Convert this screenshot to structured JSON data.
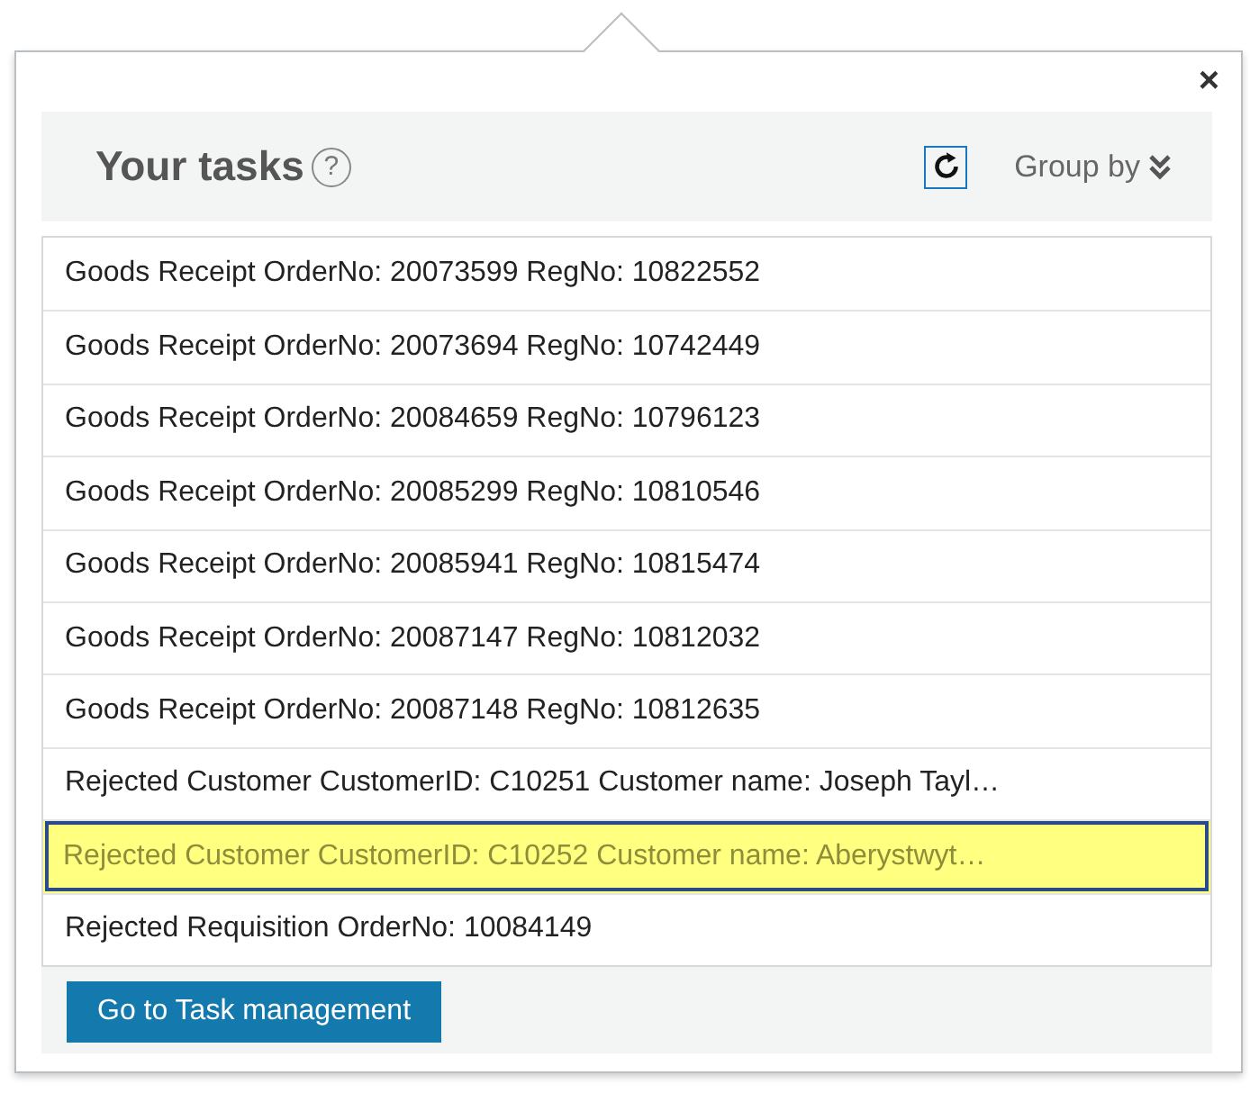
{
  "close": "×",
  "header": {
    "title": "Your tasks",
    "help": "?",
    "group_by": "Group by"
  },
  "tasks": [
    {
      "text": "Goods Receipt OrderNo: 20073599 RegNo: 10822552",
      "selected": false
    },
    {
      "text": "Goods Receipt OrderNo: 20073694 RegNo: 10742449",
      "selected": false
    },
    {
      "text": "Goods Receipt OrderNo: 20084659 RegNo: 10796123",
      "selected": false
    },
    {
      "text": "Goods Receipt OrderNo: 20085299 RegNo: 10810546",
      "selected": false
    },
    {
      "text": "Goods Receipt OrderNo: 20085941 RegNo: 10815474",
      "selected": false
    },
    {
      "text": "Goods Receipt OrderNo: 20087147 RegNo: 10812032",
      "selected": false
    },
    {
      "text": "Goods Receipt OrderNo: 20087148 RegNo: 10812635",
      "selected": false
    },
    {
      "text": "Rejected Customer CustomerID: C10251 Customer name: Joseph Tayl…",
      "selected": false
    },
    {
      "text": "Rejected Customer CustomerID: C10252 Customer name: Aberystwyt…",
      "selected": true
    },
    {
      "text": "Rejected Requisition OrderNo: 10084149",
      "selected": false
    }
  ],
  "footer": {
    "button": "Go to Task management"
  }
}
